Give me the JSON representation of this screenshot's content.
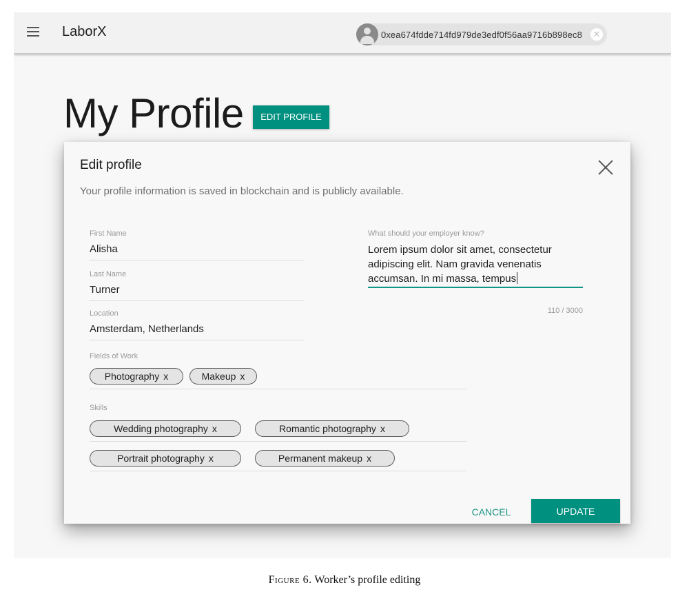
{
  "app": {
    "title": "LaborX",
    "account_address": "0xea674fdde714fd979de3edf0f56aa9716b898ec8",
    "accent_color": "#00907f"
  },
  "page": {
    "title": "My Profile",
    "edit_profile_label": "EDIT PROFILE"
  },
  "dialog": {
    "title": "Edit profile",
    "subtitle": "Your profile information is saved in blockchain and is publicly available.",
    "fields": {
      "first_name": {
        "label": "First Name",
        "value": "Alisha"
      },
      "last_name": {
        "label": "Last Name",
        "value": "Turner"
      },
      "location": {
        "label": "Location",
        "value": "Amsterdam, Netherlands"
      },
      "about": {
        "label": "What should your employer know?",
        "value": "Lorem ipsum dolor sit amet, consectetur adipiscing elit. Nam gravida venenatis accumsan. In mi massa, tempus",
        "counter": "110 / 3000"
      }
    },
    "fields_of_work": {
      "label": "Fields of Work",
      "tags": [
        "Photography",
        "Makeup"
      ]
    },
    "skills": {
      "label": "Skills",
      "tags": [
        "Wedding photography",
        "Romantic photography",
        "Portrait photography",
        "Permanent makeup"
      ]
    },
    "tag_remove_glyph": "x",
    "cancel_label": "CANCEL",
    "update_label": "UPDATE"
  },
  "caption": {
    "label": "Figure 6.",
    "text": "Worker’s profile editing"
  }
}
